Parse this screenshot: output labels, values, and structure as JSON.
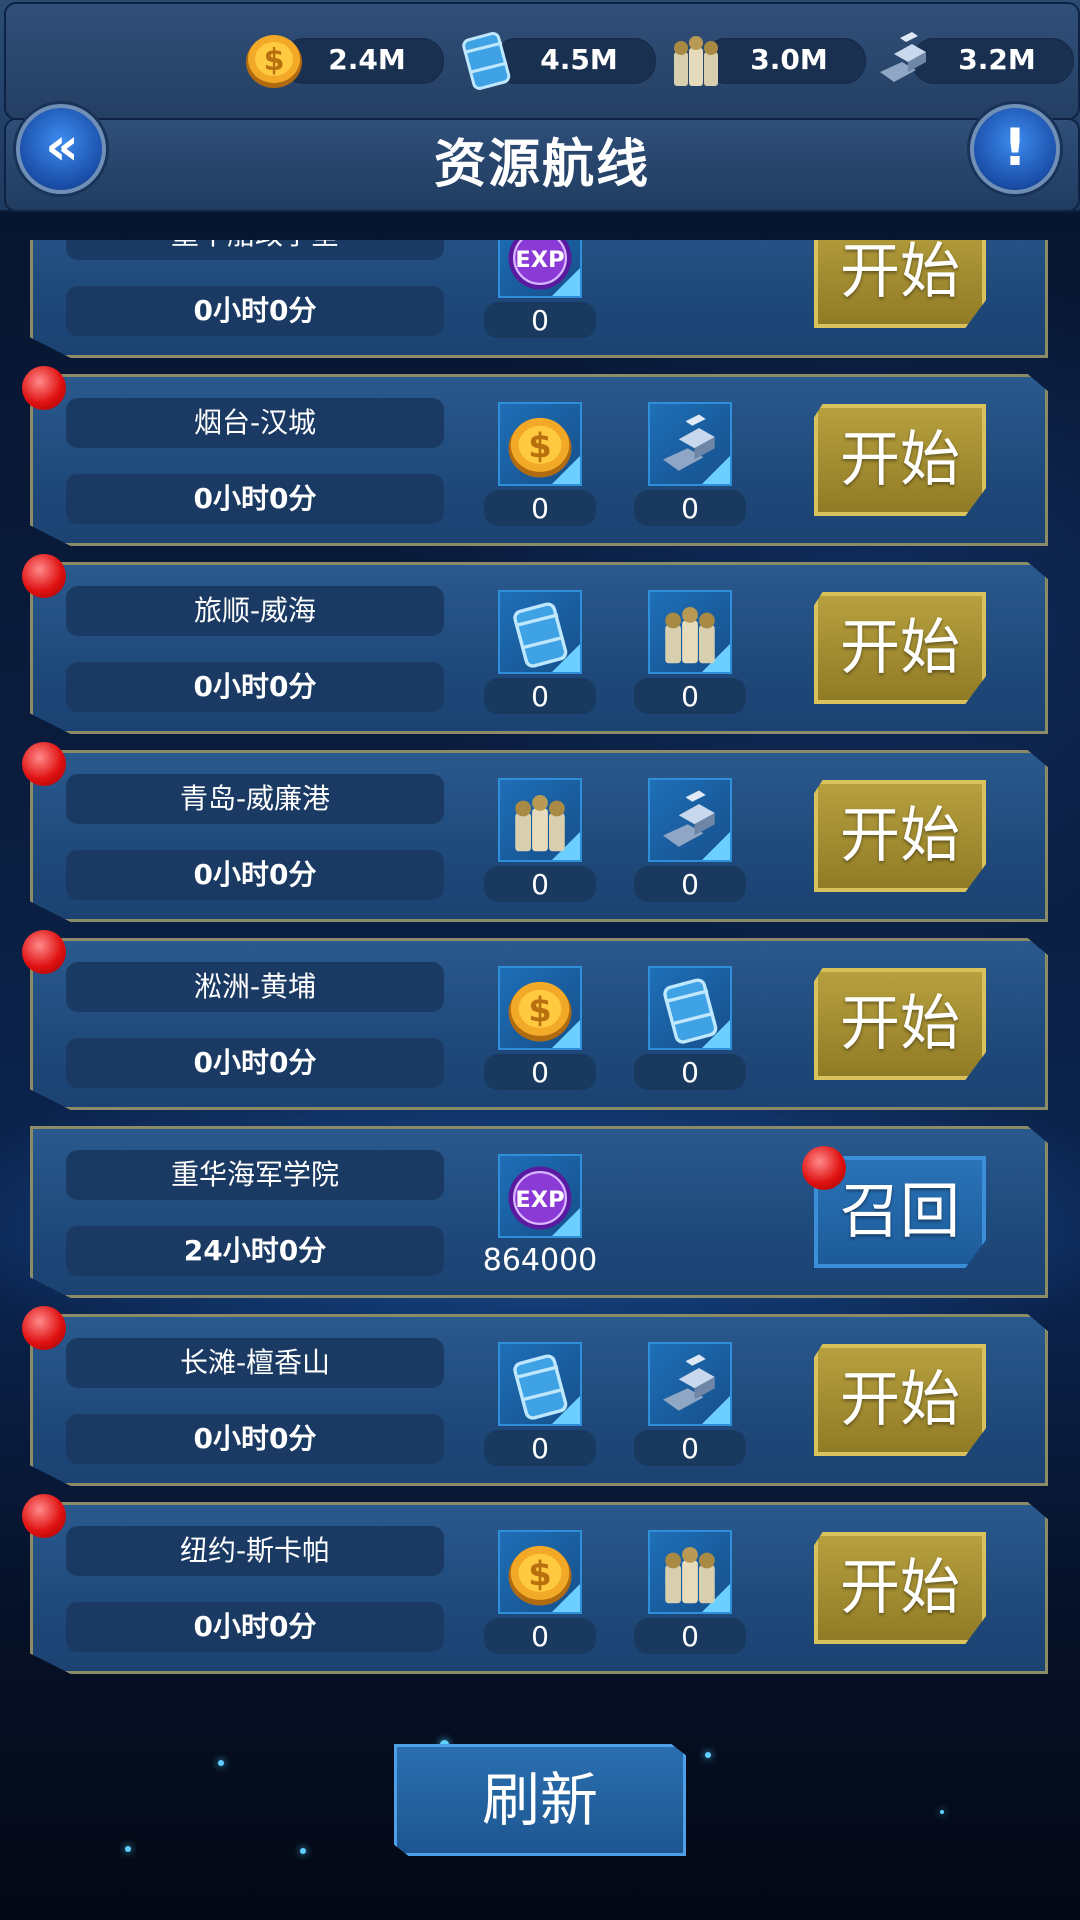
{
  "header": {
    "title": "资源航线",
    "back_icon": "double-chevron-left-icon",
    "info_icon": "exclamation-icon"
  },
  "resources": [
    {
      "icon": "gold-coin-icon",
      "value": "2.4M"
    },
    {
      "icon": "fuel-barrel-icon",
      "value": "4.5M"
    },
    {
      "icon": "ammo-shells-icon",
      "value": "3.0M"
    },
    {
      "icon": "steel-ingot-icon",
      "value": "3.2M"
    }
  ],
  "routes": [
    {
      "name": "重华船政学堂",
      "time": "0小时0分",
      "rewards": [
        {
          "icon": "exp-icon",
          "count": "0"
        }
      ],
      "action": "开始",
      "badge": false
    },
    {
      "name": "烟台-汉城",
      "time": "0小时0分",
      "rewards": [
        {
          "icon": "gold-coin-icon",
          "count": "0"
        },
        {
          "icon": "steel-ingot-icon",
          "count": "0"
        }
      ],
      "action": "开始",
      "badge": true
    },
    {
      "name": "旅顺-威海",
      "time": "0小时0分",
      "rewards": [
        {
          "icon": "fuel-barrel-icon",
          "count": "0"
        },
        {
          "icon": "ammo-shells-icon",
          "count": "0"
        }
      ],
      "action": "开始",
      "badge": true
    },
    {
      "name": "青岛-威廉港",
      "time": "0小时0分",
      "rewards": [
        {
          "icon": "ammo-shells-icon",
          "count": "0"
        },
        {
          "icon": "steel-ingot-icon",
          "count": "0"
        }
      ],
      "action": "开始",
      "badge": true
    },
    {
      "name": "淞洲-黄埔",
      "time": "0小时0分",
      "rewards": [
        {
          "icon": "gold-coin-icon",
          "count": "0"
        },
        {
          "icon": "fuel-barrel-icon",
          "count": "0"
        }
      ],
      "action": "开始",
      "badge": true
    },
    {
      "name": "重华海军学院",
      "time": "24小时0分",
      "rewards": [
        {
          "icon": "exp-icon",
          "count": "864000"
        }
      ],
      "action": "召回",
      "badge": false
    },
    {
      "name": "长滩-檀香山",
      "time": "0小时0分",
      "rewards": [
        {
          "icon": "fuel-barrel-icon",
          "count": "0"
        },
        {
          "icon": "steel-ingot-icon",
          "count": "0"
        }
      ],
      "action": "开始",
      "badge": true
    },
    {
      "name": "纽约-斯卡帕",
      "time": "0小时0分",
      "rewards": [
        {
          "icon": "gold-coin-icon",
          "count": "0"
        },
        {
          "icon": "ammo-shells-icon",
          "count": "0"
        }
      ],
      "action": "开始",
      "badge": true
    }
  ],
  "refresh_label": "刷新",
  "colors": {
    "start_button": "#b8a13f",
    "recall_button": "#2a74b9",
    "row_bg": "#244f82",
    "badge_red": "#e01212"
  }
}
